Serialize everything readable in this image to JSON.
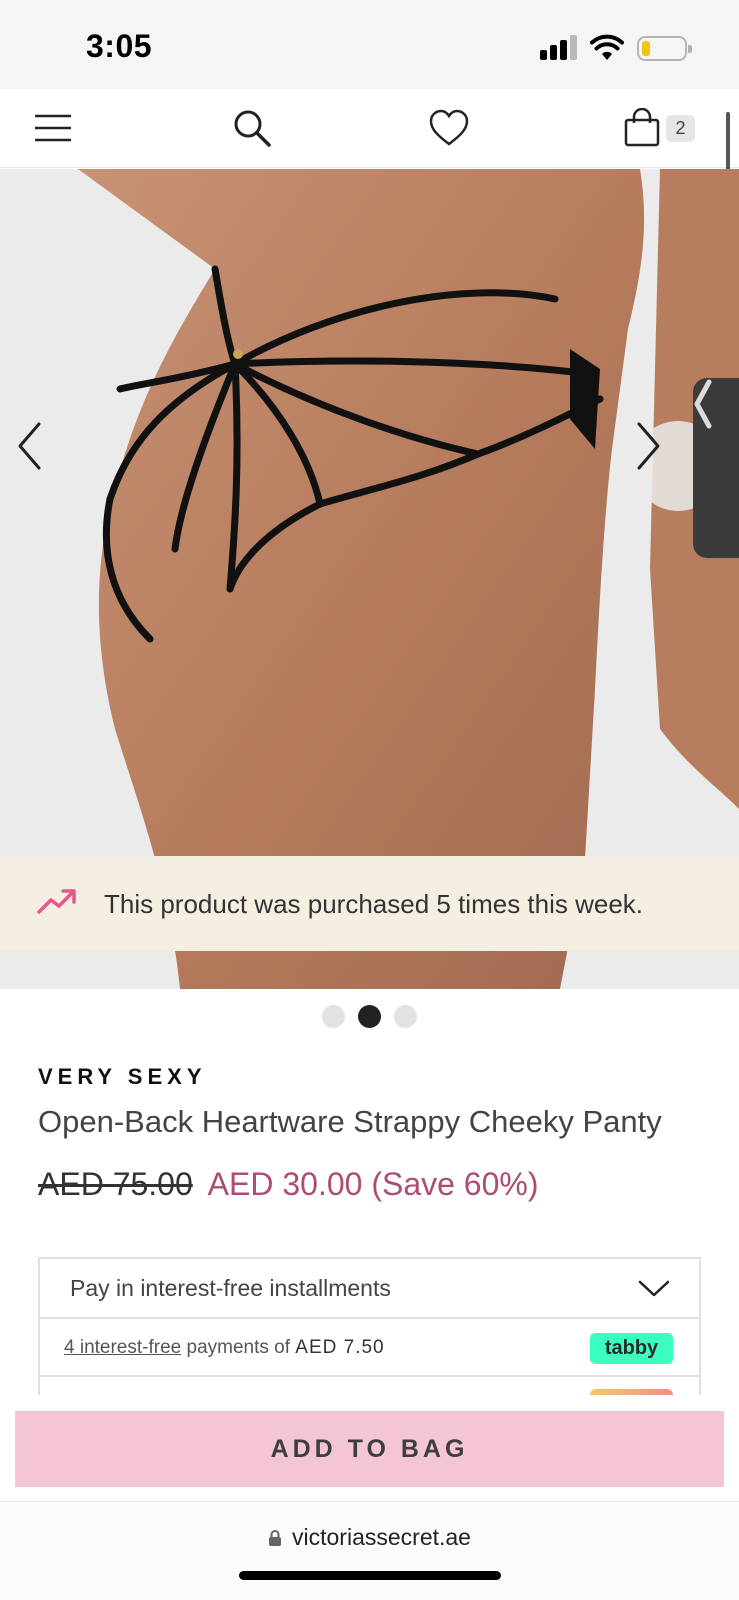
{
  "status_bar": {
    "time": "3:05",
    "icons": [
      "signal-icon",
      "wifi-icon",
      "battery-icon"
    ],
    "battery_color": "#f1c40f"
  },
  "nav": {
    "icons": [
      "menu-icon",
      "search-icon",
      "heart-icon",
      "shopping-bag-icon"
    ],
    "bag_count": "2"
  },
  "product_image": {
    "prev_icon": "chevron-left-icon",
    "next_icon": "chevron-right-icon",
    "side_tab_icon": "chevron-left-icon",
    "banner": {
      "icon": "trending-up-icon",
      "text": "This product was purchased 5 times this week.",
      "icon_color": "#e9568f"
    }
  },
  "carousel": {
    "dots": 3,
    "active_index": 1
  },
  "product": {
    "brand": "VERY SEXY",
    "name": "Open-Back Heartware Strappy Cheeky Panty",
    "original_price": "AED 75.00",
    "sale_price": "AED 30.00 (Save 60%)",
    "sale_color": "#ad4d74"
  },
  "installments": {
    "title": "Pay in interest-free installments",
    "chevron_icon": "chevron-down-icon",
    "tabby": {
      "link_text": "4 interest-free",
      "middle_text": " payments of ",
      "amount": "AED 7.50",
      "badge": "tabby",
      "badge_color": "#3bffc1"
    }
  },
  "cta": {
    "add_to_bag": "ADD TO BAG",
    "button_color": "#f4c5d3"
  },
  "browser": {
    "url": "victoriassecret.ae",
    "lock_icon": "lock-icon"
  }
}
